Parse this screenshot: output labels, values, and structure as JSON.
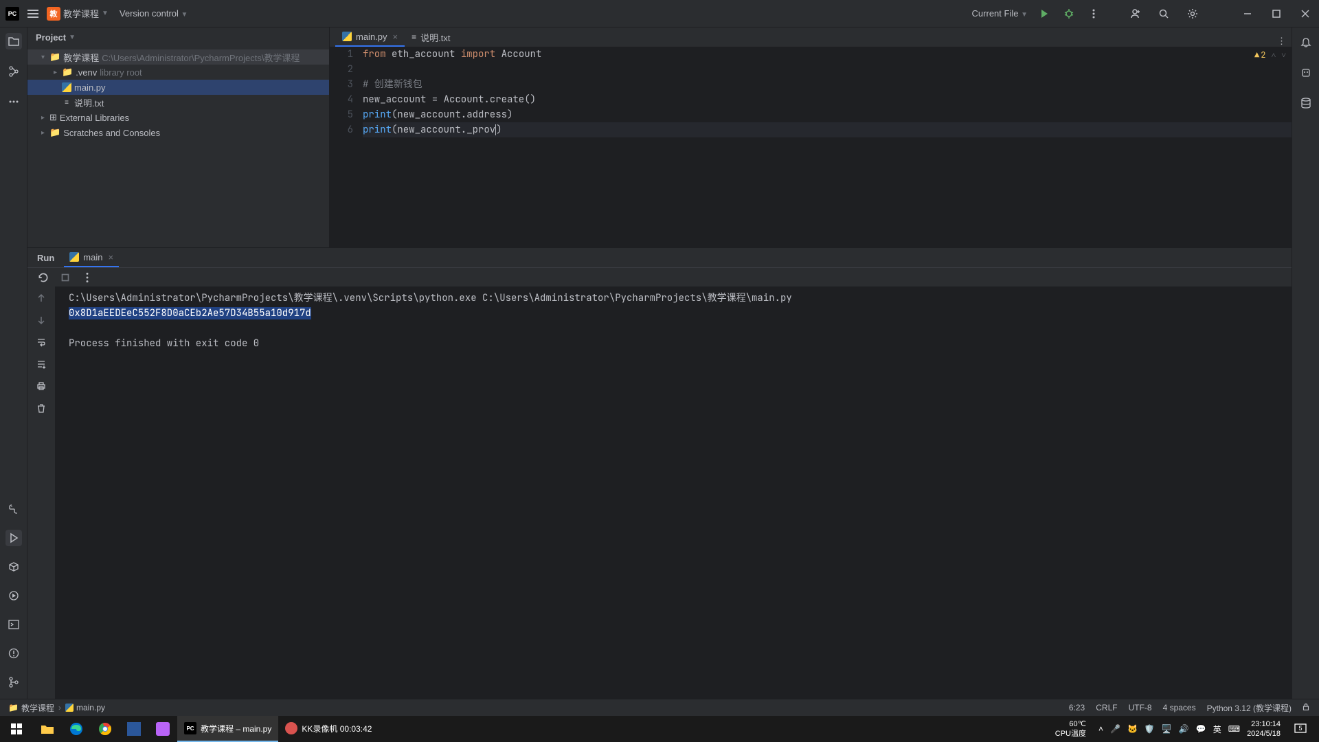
{
  "topbar": {
    "logo": "PC",
    "proj_initial": "教",
    "project_name": "教学课程",
    "vcs": "Version control",
    "current_file": "Current File"
  },
  "project": {
    "title": "Project",
    "root": "教学课程",
    "root_path": "C:\\Users\\Administrator\\PycharmProjects\\教学课程",
    "venv": ".venv",
    "venv_hint": "library root",
    "main": "main.py",
    "readme": "说明.txt",
    "ext_lib": "External Libraries",
    "scratches": "Scratches and Consoles"
  },
  "tabs": {
    "t1": "main.py",
    "t2": "说明.txt"
  },
  "code": {
    "l1a": "from",
    "l1b": " eth_account ",
    "l1c": "import",
    "l1d": " Account",
    "l2": "",
    "l3": "# 创建新钱包",
    "l4": "new_account = Account.create()",
    "l5a": "print",
    "l5b": "(new_account.address)",
    "l6a": "print",
    "l6b": "(new_account._prov",
    "l6c": ")"
  },
  "warnings": {
    "count": "2"
  },
  "run": {
    "label": "Run",
    "tab": "main",
    "cmd": "C:\\Users\\Administrator\\PycharmProjects\\教学课程\\.venv\\Scripts\\python.exe C:\\Users\\Administrator\\PycharmProjects\\教学课程\\main.py",
    "address": "0x8D1aEEDEeC552F8D0aCEb2Ae57D34B55a10d917d",
    "exit": "Process finished with exit code 0"
  },
  "breadcrumb": {
    "proj": "教学课程",
    "file": "main.py",
    "cursor": "6:23",
    "eol": "CRLF",
    "enc": "UTF-8",
    "indent": "4 spaces",
    "interp": "Python 3.12 (教学课程)"
  },
  "taskbar": {
    "pycharm": "教学课程 – main.py",
    "kk": "KK录像机 00:03:42",
    "temp": "60℃",
    "temp_label": "CPU温度",
    "ime": "英",
    "time": "23:10:14",
    "date": "2024/5/18",
    "notif_count": "5"
  }
}
